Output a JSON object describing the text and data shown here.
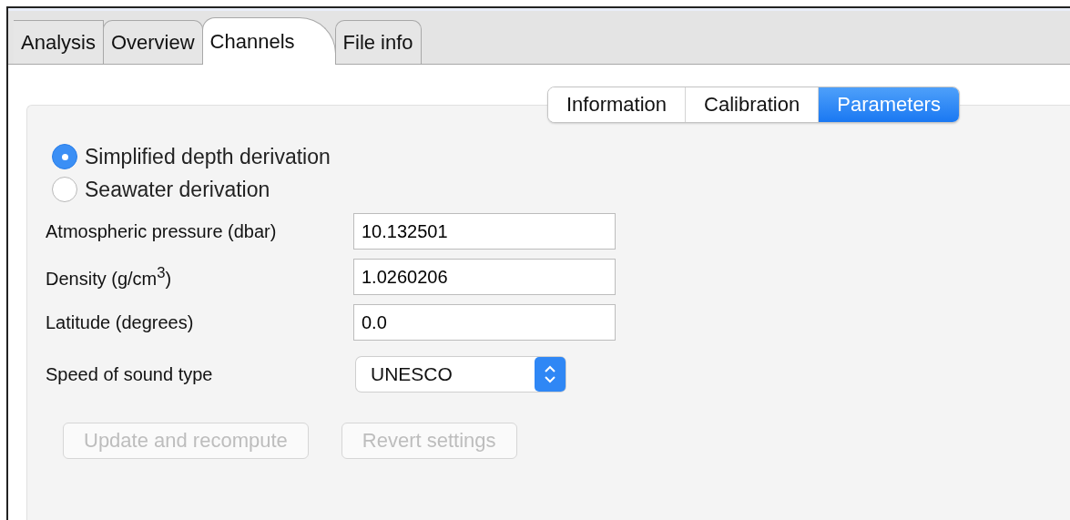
{
  "tabs": [
    {
      "label": "Analysis",
      "selected": false
    },
    {
      "label": "Overview",
      "selected": false
    },
    {
      "label": "Channels",
      "selected": true
    },
    {
      "label": "File info",
      "selected": false
    }
  ],
  "subtabs": [
    {
      "label": "Information",
      "selected": false
    },
    {
      "label": "Calibration",
      "selected": false
    },
    {
      "label": "Parameters",
      "selected": true
    }
  ],
  "derivation": [
    {
      "label": "Simplified depth derivation",
      "selected": true
    },
    {
      "label": "Seawater derivation",
      "selected": false
    }
  ],
  "fields": [
    {
      "label": "Atmospheric pressure (dbar)",
      "value": "10.132501"
    },
    {
      "label": "Density (g/cm$^{3}$)",
      "value": "1.0260206"
    },
    {
      "label": "Latitude (degrees)",
      "value": "0.0"
    }
  ],
  "speed_of_sound": {
    "label": "Speed of sound type",
    "value": "UNESCO"
  },
  "buttons": [
    {
      "label": "Update and recompute",
      "disabled": true
    },
    {
      "label": "Revert settings",
      "disabled": true
    }
  ]
}
